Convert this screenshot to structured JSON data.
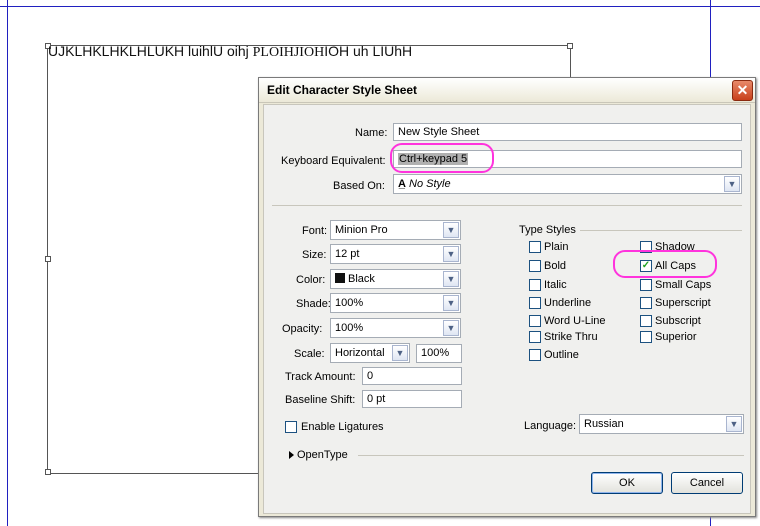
{
  "canvas": {
    "frame_text": "UJKLHKLHKLHLUKH luihlU oihj ",
    "frame_text_serif": "PLOIHJIOH",
    "frame_text_tail": "IOH uh LIUhH"
  },
  "dialog": {
    "title": "Edit Character Style Sheet",
    "close_glyph": "✕",
    "name": {
      "label": "Name:",
      "value": "New Style Sheet"
    },
    "keyboard": {
      "label": "Keyboard Equivalent:",
      "value": "Ctrl+keypad 5"
    },
    "based_on": {
      "label": "Based On:",
      "icon": "character-style-icon",
      "value": "No Style"
    },
    "font": {
      "label": "Font:",
      "value": "Minion Pro"
    },
    "size": {
      "label": "Size:",
      "value": "12 pt"
    },
    "color": {
      "label": "Color:",
      "value": "Black",
      "swatch": "#111111"
    },
    "shade": {
      "label": "Shade:",
      "value": "100%"
    },
    "opacity": {
      "label": "Opacity:",
      "value": "100%"
    },
    "scale": {
      "label": "Scale:",
      "value": "Horizontal",
      "amount": "100%"
    },
    "track": {
      "label": "Track Amount:",
      "value": "0"
    },
    "baseline": {
      "label": "Baseline Shift:",
      "value": "0 pt"
    },
    "ligatures": {
      "label": "Enable Ligatures",
      "checked": false
    },
    "type_styles": {
      "header": "Type Styles",
      "left": [
        {
          "label": "Plain",
          "checked": false
        },
        {
          "label": "Bold",
          "checked": false
        },
        {
          "label": "Italic",
          "checked": false
        },
        {
          "label": "Underline",
          "checked": false
        },
        {
          "label": "Word U-Line",
          "checked": false
        },
        {
          "label": "Strike Thru",
          "checked": false
        },
        {
          "label": "Outline",
          "checked": false
        }
      ],
      "right": [
        {
          "label": "Shadow",
          "checked": false
        },
        {
          "label": "All Caps",
          "checked": true
        },
        {
          "label": "Small Caps",
          "checked": false
        },
        {
          "label": "Superscript",
          "checked": false
        },
        {
          "label": "Subscript",
          "checked": false
        },
        {
          "label": "Superior",
          "checked": false
        }
      ]
    },
    "language": {
      "label": "Language:",
      "value": "Russian"
    },
    "opentype": {
      "label": "OpenType"
    },
    "ok_label": "OK",
    "cancel_label": "Cancel",
    "check_glyph": "✓",
    "arrow_glyph": "▼",
    "highlight_color": "#ff33dd"
  }
}
